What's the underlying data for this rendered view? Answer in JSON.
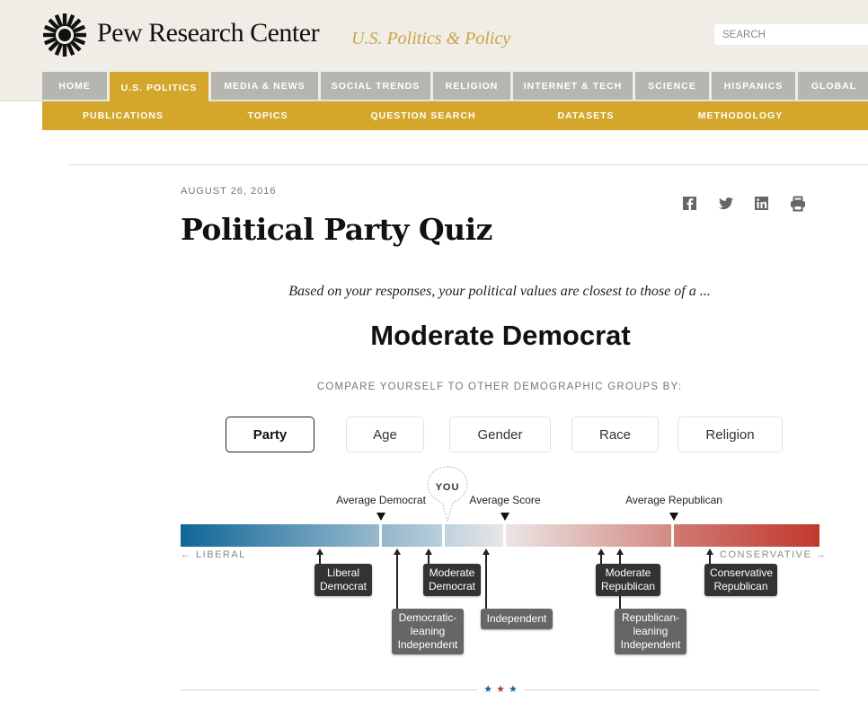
{
  "header": {
    "brand": "Pew Research Center",
    "section": "U.S. Politics & Policy",
    "search_placeholder": "SEARCH",
    "logo_icon": "pew-sunburst-logo-icon"
  },
  "nav": {
    "items": [
      {
        "label": "HOME",
        "active": false
      },
      {
        "label": "U.S. POLITICS",
        "active": true
      },
      {
        "label": "MEDIA & NEWS",
        "active": false
      },
      {
        "label": "SOCIAL TRENDS",
        "active": false
      },
      {
        "label": "RELIGION",
        "active": false
      },
      {
        "label": "INTERNET & TECH",
        "active": false
      },
      {
        "label": "SCIENCE",
        "active": false
      },
      {
        "label": "HISPANICS",
        "active": false
      },
      {
        "label": "GLOBAL",
        "active": false
      }
    ],
    "active_color": "#d4a72c",
    "inactive_color": "#b6b6b0"
  },
  "subnav": {
    "items": [
      "PUBLICATIONS",
      "TOPICS",
      "QUESTION SEARCH",
      "DATASETS",
      "METHODOLOGY"
    ]
  },
  "article": {
    "date": "AUGUST 26, 2016",
    "title": "Political Party Quiz",
    "share_icons": [
      "facebook-icon",
      "twitter-icon",
      "linkedin-icon",
      "print-icon"
    ]
  },
  "quiz": {
    "lead": "Based on your responses, your political values are closest to those of a ...",
    "result": "Moderate Democrat",
    "compare_label": "COMPARE YOURSELF TO OTHER DEMOGRAPHIC GROUPS BY:",
    "tabs": [
      {
        "label": "Party",
        "active": true
      },
      {
        "label": "Age",
        "active": false
      },
      {
        "label": "Gender",
        "active": false
      },
      {
        "label": "Race",
        "active": false
      },
      {
        "label": "Religion",
        "active": false
      }
    ]
  },
  "scale": {
    "left_label": "← LIBERAL",
    "right_label": "CONSERVATIVE →",
    "you_label": "YOU",
    "markers": [
      {
        "label": "Average Democrat"
      },
      {
        "label": "Average Score"
      },
      {
        "label": "Average Republican"
      }
    ],
    "groups": [
      {
        "line1": "Liberal",
        "line2": "Democrat",
        "line3": ""
      },
      {
        "line1": "Democratic-",
        "line2": "leaning",
        "line3": "Independent"
      },
      {
        "line1": "Moderate",
        "line2": "Democrat",
        "line3": ""
      },
      {
        "line1": "Independent",
        "line2": "",
        "line3": ""
      },
      {
        "line1": "Moderate",
        "line2": "Republican",
        "line3": ""
      },
      {
        "line1": "Republican-",
        "line2": "leaning",
        "line3": "Independent"
      },
      {
        "line1": "Conservative",
        "line2": "Republican",
        "line3": ""
      }
    ],
    "colors": {
      "liberal": "#0f6697",
      "neutral": "#e8e6e4",
      "conservative": "#c1382d"
    }
  },
  "divider": {
    "stars": [
      "★",
      "★",
      "★"
    ],
    "star_colors": [
      "#1b5f8f",
      "#c1382d",
      "#1b5f8f"
    ]
  }
}
